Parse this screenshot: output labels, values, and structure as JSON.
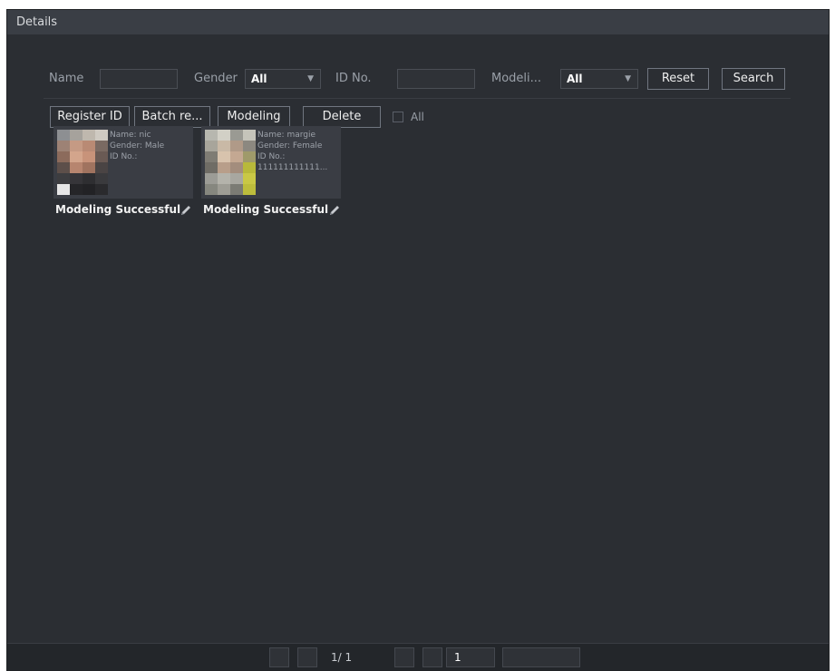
{
  "window": {
    "title": "Details"
  },
  "filters": {
    "name_label": "Name",
    "name_value": "",
    "gender_label": "Gender",
    "gender_value": "All",
    "id_label": "ID No.",
    "id_value": "",
    "modeling_label": "Modeli...",
    "modeling_value": "All",
    "reset_label": "Reset",
    "search_label": "Search"
  },
  "actions": {
    "register_label": "Register ID",
    "batch_label": "Batch re...",
    "modeling_label": "Modeling",
    "delete_label": "Delete",
    "all_label": "All"
  },
  "cards": [
    {
      "name": "Name: nic",
      "gender": "Gender: Male",
      "id": "ID No.:",
      "id_value": "",
      "status": "Modeling Successful",
      "edit_icon": "pencil-icon"
    },
    {
      "name": "Name: margie",
      "gender": "Gender: Female",
      "id": "ID No.:",
      "id_value": "111111111111...",
      "status": "Modeling Successful",
      "edit_icon": "pencil-icon"
    }
  ],
  "pagination": {
    "page_text": "1/ 1",
    "goto_value": "1"
  },
  "colors": {
    "window_bg": "#2b2e33",
    "title_bar": "#3a3e45",
    "card_bg": "#3a3d44",
    "footer_bg": "#23262a"
  }
}
